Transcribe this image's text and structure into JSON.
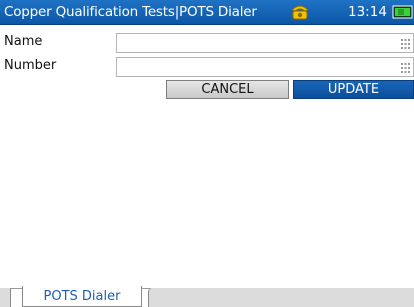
{
  "window": {
    "title": "Copper Qualification Tests|POTS Dialer",
    "time": "13:14",
    "status_icons": [
      "phone-icon",
      "battery-icon"
    ]
  },
  "form": {
    "name_label": "Name",
    "name_value": "",
    "number_label": "Number",
    "number_value": "",
    "cancel_label": "CANCEL",
    "update_label": "UPDATE"
  },
  "tabs": [
    {
      "label": "POTS Dialer",
      "active": true
    }
  ],
  "colors": {
    "titlebar": "#1565c0",
    "accent": "#0b4f9c",
    "active_tab_text": "#1b5fb0",
    "phone_icon": "#f2c200",
    "battery_icon": "#3bd23b"
  }
}
